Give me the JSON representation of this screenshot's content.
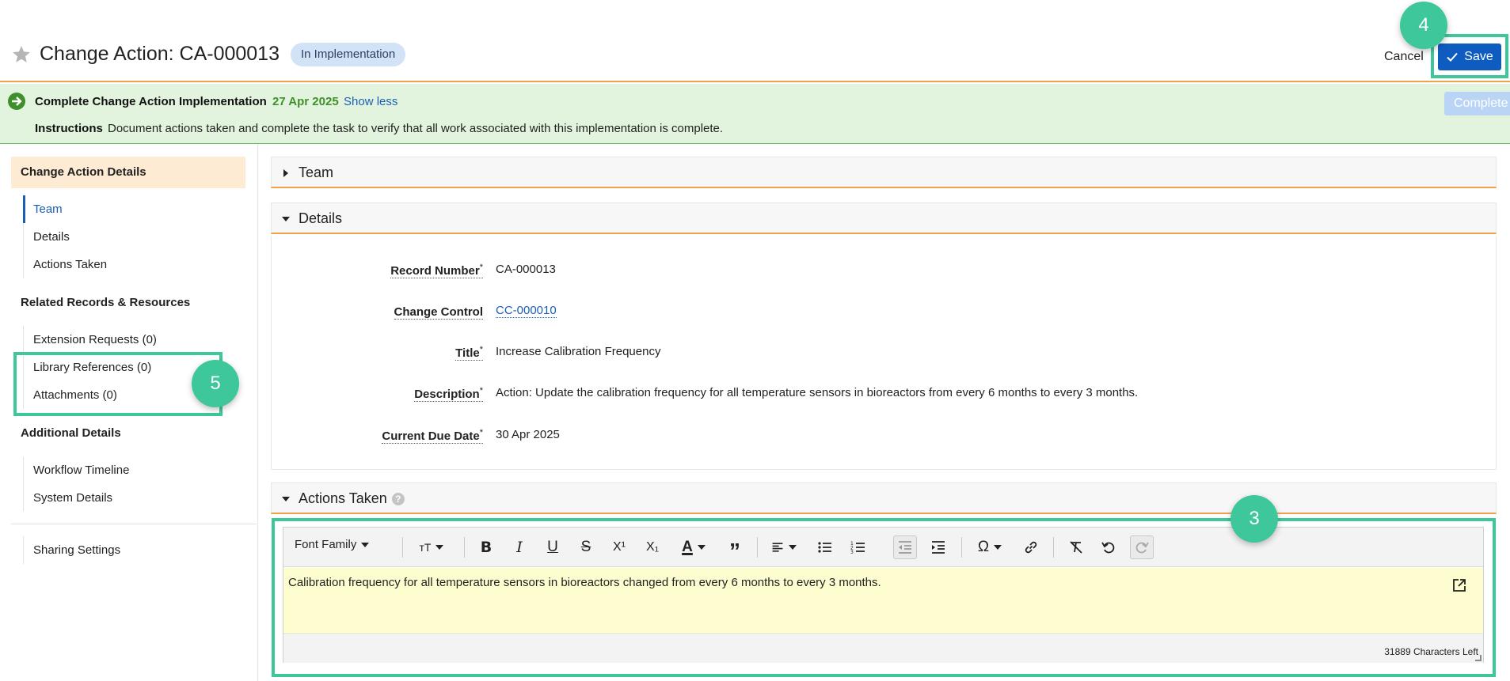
{
  "header": {
    "title": "Change Action: CA-000013",
    "status": "In Implementation",
    "cancel_label": "Cancel",
    "save_label": "Save"
  },
  "banner": {
    "task": "Complete Change Action Implementation",
    "date": "27 Apr 2025",
    "show_less": "Show less",
    "instructions_label": "Instructions",
    "instructions_text": "Document actions taken and complete the task to verify that all work associated with this implementation is complete.",
    "complete_label": "Complete"
  },
  "sidebar": {
    "section_active": "Change Action Details",
    "items": [
      "Team",
      "Details",
      "Actions Taken"
    ],
    "related_heading": "Related Records & Resources",
    "related_items": [
      "Extension Requests (0)",
      "Library References (0)",
      "Attachments (0)"
    ],
    "additional_heading": "Additional Details",
    "additional_items": [
      "Workflow Timeline",
      "System Details"
    ],
    "sharing": "Sharing Settings"
  },
  "panels": {
    "team": "Team",
    "details": "Details",
    "actions_taken": "Actions Taken"
  },
  "details": {
    "fields": [
      {
        "label": "Record Number",
        "required": "*",
        "value": "CA-000013"
      },
      {
        "label": "Change Control",
        "required": "",
        "value": "CC-000010"
      },
      {
        "label": "Title",
        "required": "*",
        "value": "Increase Calibration Frequency"
      },
      {
        "label": "Description",
        "required": "*",
        "value": "Action: Update the calibration frequency for all temperature sensors in bioreactors from every 6 months to every 3 months."
      },
      {
        "label": "Current Due Date",
        "required": "*",
        "value": "30 Apr 2025"
      }
    ]
  },
  "editor": {
    "font_family": "Font Family",
    "content": "Calibration frequency for all temperature sensors in bioreactors changed from every 6 months to every 3 months.",
    "chars_left": "31889 Characters Left"
  },
  "annotations": {
    "callout_3": "3",
    "callout_4": "4",
    "callout_5": "5"
  },
  "colors": {
    "accent": "#0f5cc0",
    "highlight": "#3ec79a",
    "orange_rule": "#f0a14a",
    "banner_bg": "#e3f4de"
  }
}
